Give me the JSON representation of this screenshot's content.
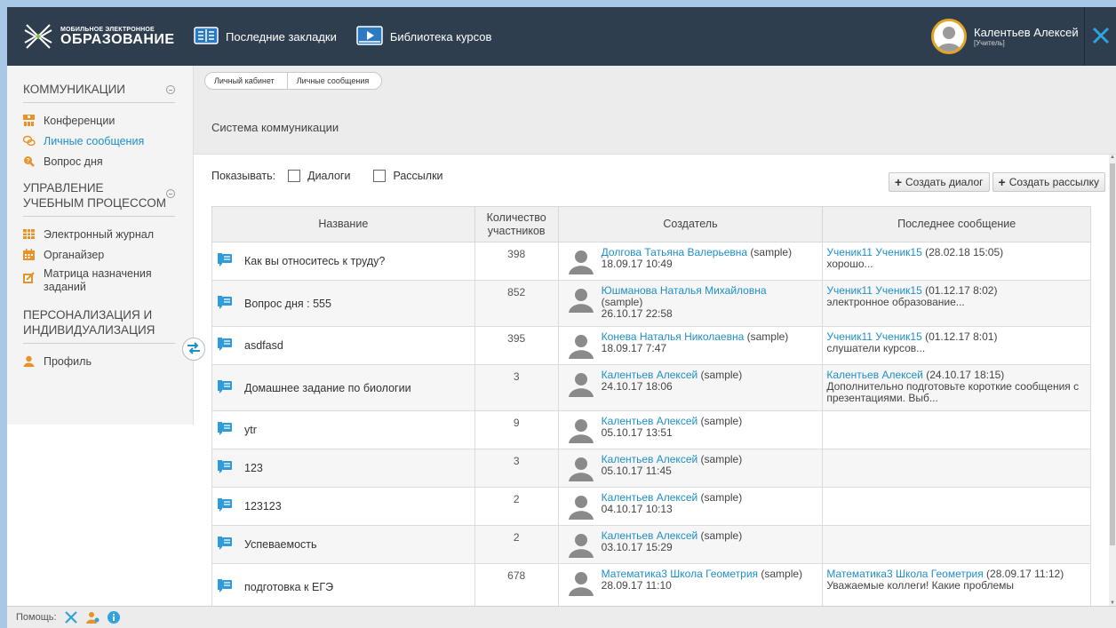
{
  "header": {
    "logo_small": "МОБИЛЬНОЕ ЭЛЕКТРОННОЕ",
    "logo_big": "ОБРАЗОВАНИЕ",
    "nav": [
      {
        "label": "Последние закладки",
        "icon": "bookmarks-icon"
      },
      {
        "label": "Библиотека курсов",
        "icon": "course-library-icon"
      }
    ],
    "user_name": "Калентьев Алексей",
    "user_role": "[Учитель]"
  },
  "sidebar": {
    "sections": [
      {
        "title": "КОММУНИКАЦИИ",
        "items": [
          {
            "label": "Конференции",
            "icon": "conference-icon"
          },
          {
            "label": "Личные сообщения",
            "icon": "messages-icon",
            "active": true
          },
          {
            "label": "Вопрос дня",
            "icon": "question-icon"
          }
        ]
      },
      {
        "title": "УПРАВЛЕНИЕ УЧЕБНЫМ ПРОЦЕССОМ",
        "items": [
          {
            "label": "Электронный журнал",
            "icon": "journal-icon"
          },
          {
            "label": "Органайзер",
            "icon": "calendar-icon"
          },
          {
            "label": "Матрица назначения заданий",
            "icon": "assignment-icon"
          }
        ]
      },
      {
        "title": "ПЕРСОНАЛИЗАЦИЯ И ИНДИВИДУАЛИЗАЦИЯ",
        "items": [
          {
            "label": "Профиль",
            "icon": "profile-icon"
          }
        ]
      }
    ]
  },
  "breadcrumb": [
    "Личный кабинет",
    "Личные сообщения"
  ],
  "page_title": "Система коммуникации",
  "filters": {
    "label": "Показывать:",
    "dialogs": "Диалоги",
    "mailings": "Рассылки"
  },
  "buttons": {
    "create_dialog": "Создать диалог",
    "create_mailing": "Создать рассылку"
  },
  "table": {
    "headers": [
      "Название",
      "Количество участников",
      "Создатель",
      "Последнее сообщение"
    ],
    "rows": [
      {
        "name": "Как вы относитесь к труду?",
        "count": "398",
        "creator": "Долгова Татьяна Валерьевна",
        "creator_suffix": " (sample)",
        "date": "18.09.17 10:49",
        "last_author": "Ученик11 Ученик15",
        "last_date": " (28.02.18 15:05)",
        "last_text": "хорошо..."
      },
      {
        "name": "Вопрос дня : 555",
        "count": "852",
        "creator": "Юшманова Наталья Михайловна",
        "creator_suffix": "(sample)",
        "date": "26.10.17 22:58",
        "last_author": "Ученик11 Ученик15",
        "last_date": " (01.12.17 8:02)",
        "last_text": "электронное образование..."
      },
      {
        "name": "asdfasd",
        "count": "395",
        "creator": "Конева Наталья Николаевна",
        "creator_suffix": " (sample)",
        "date": "18.09.17 7:47",
        "last_author": "Ученик11 Ученик15",
        "last_date": " (01.12.17 8:01)",
        "last_text": "слушатели курсов..."
      },
      {
        "name": "Домашнее задание по биологии",
        "count": "3",
        "creator": "Калентьев Алексей",
        "creator_suffix": " (sample)",
        "date": "24.10.17 18:06",
        "last_author": "Калентьев Алексей",
        "last_date": " (24.10.17 18:15)",
        "last_text": "Дополнительно подготовьте короткие сообщения с презентациями. Выб..."
      },
      {
        "name": "ytr",
        "count": "9",
        "creator": "Калентьев Алексей",
        "creator_suffix": " (sample)",
        "date": "05.10.17 13:51",
        "last_author": "",
        "last_date": "",
        "last_text": ""
      },
      {
        "name": "123",
        "count": "3",
        "creator": "Калентьев Алексей",
        "creator_suffix": " (sample)",
        "date": "05.10.17 11:45",
        "last_author": "",
        "last_date": "",
        "last_text": ""
      },
      {
        "name": "123123",
        "count": "2",
        "creator": "Калентьев Алексей",
        "creator_suffix": " (sample)",
        "date": "04.10.17 10:13",
        "last_author": "",
        "last_date": "",
        "last_text": ""
      },
      {
        "name": "Успеваемость",
        "count": "2",
        "creator": "Калентьев Алексей",
        "creator_suffix": " (sample)",
        "date": "03.10.17 15:29",
        "last_author": "",
        "last_date": "",
        "last_text": ""
      },
      {
        "name": "подготовка к ЕГЭ",
        "count": "678",
        "creator": "Математика3 Школа Геометрия",
        "creator_suffix": " (sample)",
        "date": "28.09.17 11:10",
        "last_author": "Математика3 Школа Геометрия",
        "last_date": " (28.09.17 11:12)",
        "last_text": "Уважаемые коллеги! Какие проблемы"
      }
    ]
  },
  "footer": {
    "help_label": "Помощь:"
  },
  "colors": {
    "topbar": "#2e3e4e",
    "accent": "#1e8fc8",
    "avatar_ring": "#e2a526",
    "icon_orange": "#e8932a"
  }
}
